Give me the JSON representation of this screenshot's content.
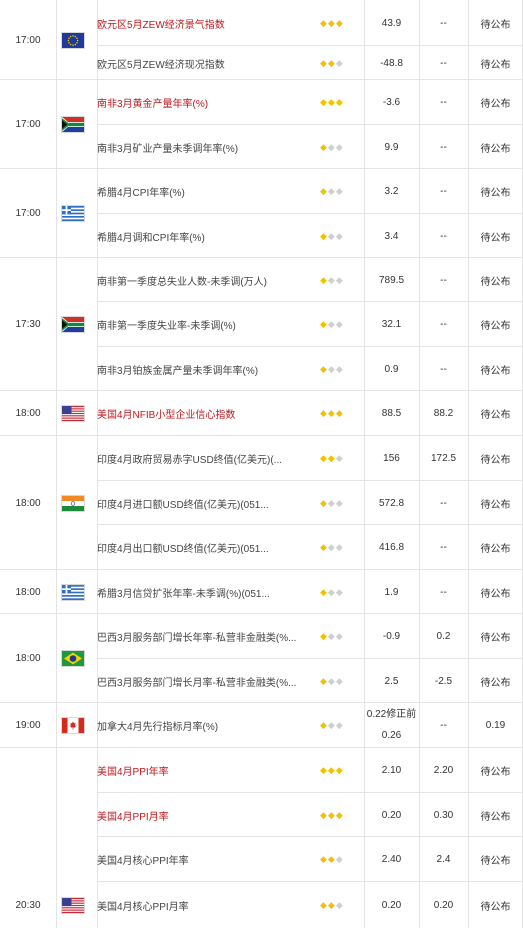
{
  "rows": [
    {
      "name": "欧元区5月ZEW经济景气指数",
      "red": true,
      "stars": 3,
      "prev": "43.9",
      "fore": "--",
      "act": "待公布"
    },
    {
      "name": "欧元区5月ZEW经济现况指数",
      "red": false,
      "stars": 2,
      "prev": "-48.8",
      "fore": "--",
      "act": "待公布"
    },
    {
      "name": "南非3月黄金产量年率(%)",
      "red": true,
      "stars": 3,
      "prev": "-3.6",
      "fore": "--",
      "act": "待公布"
    },
    {
      "name": "南非3月矿业产量未季调年率(%)",
      "red": false,
      "stars": 1,
      "prev": "9.9",
      "fore": "--",
      "act": "待公布"
    },
    {
      "name": "希腊4月CPI年率(%)",
      "red": false,
      "stars": 1,
      "prev": "3.2",
      "fore": "--",
      "act": "待公布"
    },
    {
      "name": "希腊4月调和CPI年率(%)",
      "red": false,
      "stars": 1,
      "prev": "3.4",
      "fore": "--",
      "act": "待公布"
    },
    {
      "name": "南非第一季度总失业人数-未季调(万人)",
      "red": false,
      "stars": 1,
      "prev": "789.5",
      "fore": "--",
      "act": "待公布"
    },
    {
      "name": "南非第一季度失业率-未季调(%)",
      "red": false,
      "stars": 1,
      "prev": "32.1",
      "fore": "--",
      "act": "待公布"
    },
    {
      "name": "南非3月铂族金属产量未季调年率(%)",
      "red": false,
      "stars": 1,
      "prev": "0.9",
      "fore": "--",
      "act": "待公布"
    },
    {
      "name": "美国4月NFIB小型企业信心指数",
      "red": true,
      "stars": 3,
      "prev": "88.5",
      "fore": "88.2",
      "act": "待公布"
    },
    {
      "name": "印度4月政府贸易赤字USD终值(亿美元)(...",
      "red": false,
      "stars": 2,
      "prev": "156",
      "fore": "172.5",
      "act": "待公布"
    },
    {
      "name": "印度4月进口额USD终值(亿美元)(051...",
      "red": false,
      "stars": 1,
      "prev": "572.8",
      "fore": "--",
      "act": "待公布"
    },
    {
      "name": "印度4月出口额USD终值(亿美元)(051...",
      "red": false,
      "stars": 1,
      "prev": "416.8",
      "fore": "--",
      "act": "待公布"
    },
    {
      "name": "希腊3月信贷扩张年率-未季调(%)(051...",
      "red": false,
      "stars": 1,
      "prev": "1.9",
      "fore": "--",
      "act": "待公布"
    },
    {
      "name": "巴西3月服务部门增长年率-私营非金融类(%...",
      "red": false,
      "stars": 1,
      "prev": "-0.9",
      "fore": "0.2",
      "act": "待公布"
    },
    {
      "name": "巴西3月服务部门增长月率-私营非金融类(%...",
      "red": false,
      "stars": 1,
      "prev": "2.5",
      "fore": "-2.5",
      "act": "待公布"
    },
    {
      "name": "加拿大4月先行指标月率(%)",
      "red": false,
      "stars": 1,
      "prev": "",
      "prev_line1": "0.22修正前",
      "prev_line2": "0.26",
      "fore": "--",
      "act": "0.19"
    },
    {
      "name": "美国4月PPI年率",
      "red": true,
      "stars": 3,
      "prev": "2.10",
      "fore": "2.20",
      "act": "待公布"
    },
    {
      "name": "美国4月PPI月率",
      "red": true,
      "stars": 3,
      "prev": "0.20",
      "fore": "0.30",
      "act": "待公布"
    },
    {
      "name": "美国4月核心PPI年率",
      "red": false,
      "stars": 2,
      "prev": "2.40",
      "fore": "2.4",
      "act": "待公布"
    },
    {
      "name": "美国4月核心PPI月率",
      "red": false,
      "stars": 2,
      "prev": "0.20",
      "fore": "0.20",
      "act": "待公布"
    }
  ],
  "groups": [
    {
      "time": "17:00",
      "country": "eu"
    },
    {
      "time": "17:00",
      "country": "za"
    },
    {
      "time": "17:00",
      "country": "gr"
    },
    {
      "time": "17:30",
      "country": "za"
    },
    {
      "time": "18:00",
      "country": "us"
    },
    {
      "time": "18:00",
      "country": "in"
    },
    {
      "time": "18:00",
      "country": "gr"
    },
    {
      "time": "18:00",
      "country": "br"
    },
    {
      "time": "19:00",
      "country": "ca"
    },
    {
      "time": "20:30",
      "country": "us"
    }
  ],
  "star_icon": "diamond-icon",
  "colors": {
    "highlight_text": "#c0181e",
    "star_on": "#f2c200",
    "star_off": "#cfcfcf",
    "grid": "#e4e4e4"
  }
}
